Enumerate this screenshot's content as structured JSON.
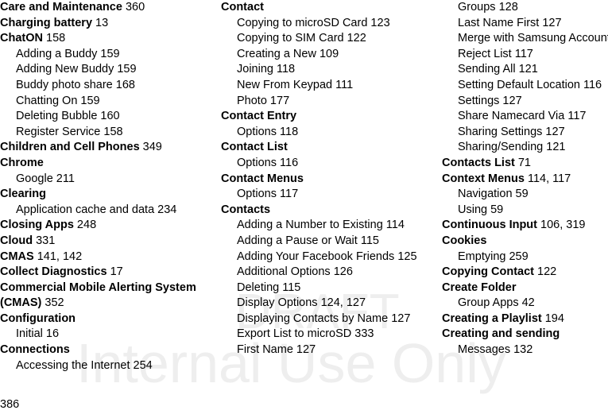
{
  "document": {
    "type": "book-index",
    "page_number": "386",
    "watermark": {
      "line1": "DRAFT",
      "line2": "Internal Use Only",
      "color": "#eeeeee"
    }
  },
  "columns": [
    {
      "id": "column-1",
      "entries": [
        {
          "level": "head",
          "title": "Care and Maintenance",
          "pages": "360"
        },
        {
          "level": "head",
          "title": "Charging battery",
          "pages": "13"
        },
        {
          "level": "head",
          "title": "ChatON",
          "pages": "158"
        },
        {
          "level": "sub",
          "title": "Adding a Buddy",
          "pages": "159"
        },
        {
          "level": "sub",
          "title": "Adding New Buddy",
          "pages": "159"
        },
        {
          "level": "sub",
          "title": "Buddy photo share",
          "pages": "168"
        },
        {
          "level": "sub",
          "title": "Chatting On",
          "pages": "159"
        },
        {
          "level": "sub",
          "title": "Deleting Bubble",
          "pages": "160"
        },
        {
          "level": "sub",
          "title": "Register Service",
          "pages": "158"
        },
        {
          "level": "head",
          "title": "Children and Cell Phones",
          "pages": "349"
        },
        {
          "level": "head",
          "title": "Chrome",
          "pages": ""
        },
        {
          "level": "sub",
          "title": "Google",
          "pages": "211"
        },
        {
          "level": "head",
          "title": "Clearing",
          "pages": ""
        },
        {
          "level": "sub",
          "title": "Application cache and data",
          "pages": "234"
        },
        {
          "level": "head",
          "title": "Closing Apps",
          "pages": "248"
        },
        {
          "level": "head",
          "title": "Cloud",
          "pages": "331"
        },
        {
          "level": "head",
          "title": "CMAS",
          "pages": "141, 142"
        },
        {
          "level": "head",
          "title": "Collect Diagnostics",
          "pages": "17"
        },
        {
          "level": "head",
          "title": "Commercial Mobile Alerting System (CMAS)",
          "pages": "352"
        },
        {
          "level": "head",
          "title": "Configuration",
          "pages": ""
        },
        {
          "level": "sub",
          "title": "Initial",
          "pages": "16"
        },
        {
          "level": "head",
          "title": "Connections",
          "pages": ""
        },
        {
          "level": "sub",
          "title": "Accessing the Internet",
          "pages": "254"
        }
      ]
    },
    {
      "id": "column-2",
      "entries": [
        {
          "level": "head",
          "title": "Contact",
          "pages": ""
        },
        {
          "level": "sub",
          "title": "Copying to microSD Card",
          "pages": "123"
        },
        {
          "level": "sub",
          "title": "Copying to SIM Card",
          "pages": "122"
        },
        {
          "level": "sub",
          "title": "Creating a New",
          "pages": "109"
        },
        {
          "level": "sub",
          "title": "Joining",
          "pages": "118"
        },
        {
          "level": "sub",
          "title": "New From Keypad",
          "pages": "111"
        },
        {
          "level": "sub",
          "title": "Photo",
          "pages": "177"
        },
        {
          "level": "head",
          "title": "Contact Entry",
          "pages": ""
        },
        {
          "level": "sub",
          "title": "Options",
          "pages": "118"
        },
        {
          "level": "head",
          "title": "Contact List",
          "pages": ""
        },
        {
          "level": "sub",
          "title": "Options",
          "pages": "116"
        },
        {
          "level": "head",
          "title": "Contact Menus",
          "pages": ""
        },
        {
          "level": "sub",
          "title": "Options",
          "pages": "117"
        },
        {
          "level": "head",
          "title": "Contacts",
          "pages": ""
        },
        {
          "level": "sub",
          "title": "Adding a Number to Existing",
          "pages": "114"
        },
        {
          "level": "sub",
          "title": "Adding a Pause or Wait",
          "pages": "115"
        },
        {
          "level": "sub",
          "title": "Adding Your Facebook Friends",
          "pages": "125"
        },
        {
          "level": "sub",
          "title": "Additional Options",
          "pages": "126"
        },
        {
          "level": "sub",
          "title": "Deleting",
          "pages": "115"
        },
        {
          "level": "sub",
          "title": "Display Options",
          "pages": "124, 127"
        },
        {
          "level": "sub",
          "title": "Displaying Contacts by Name",
          "pages": "127"
        },
        {
          "level": "sub",
          "title": "Export List to microSD",
          "pages": "333"
        },
        {
          "level": "sub",
          "title": "First Name",
          "pages": "127"
        }
      ]
    },
    {
      "id": "column-3",
      "entries": [
        {
          "level": "sub",
          "title": "Groups",
          "pages": "128"
        },
        {
          "level": "sub",
          "title": "Last Name First",
          "pages": "127"
        },
        {
          "level": "sub",
          "title": "Merge with Samsung Account",
          "pages": "116"
        },
        {
          "level": "sub",
          "title": "Reject List",
          "pages": "117"
        },
        {
          "level": "sub",
          "title": "Sending All",
          "pages": "121"
        },
        {
          "level": "sub",
          "title": "Setting Default Location",
          "pages": "116"
        },
        {
          "level": "sub",
          "title": "Settings",
          "pages": "127"
        },
        {
          "level": "sub",
          "title": "Share Namecard Via",
          "pages": "117"
        },
        {
          "level": "sub",
          "title": "Sharing Settings",
          "pages": "127"
        },
        {
          "level": "sub",
          "title": "Sharing/Sending",
          "pages": "121"
        },
        {
          "level": "head",
          "title": "Contacts List",
          "pages": "71"
        },
        {
          "level": "head",
          "title": "Context Menus",
          "pages": "114, 117"
        },
        {
          "level": "sub",
          "title": "Navigation",
          "pages": "59"
        },
        {
          "level": "sub",
          "title": "Using",
          "pages": "59"
        },
        {
          "level": "head",
          "title": "Continuous Input",
          "pages": "106, 319"
        },
        {
          "level": "head",
          "title": "Cookies",
          "pages": ""
        },
        {
          "level": "sub",
          "title": "Emptying",
          "pages": "259"
        },
        {
          "level": "head",
          "title": "Copying Contact",
          "pages": "122"
        },
        {
          "level": "head",
          "title": "Create Folder",
          "pages": ""
        },
        {
          "level": "sub",
          "title": "Group Apps",
          "pages": "42"
        },
        {
          "level": "head",
          "title": "Creating a Playlist",
          "pages": "194"
        },
        {
          "level": "head",
          "title": "Creating and sending",
          "pages": ""
        },
        {
          "level": "sub",
          "title": "Messages",
          "pages": "132"
        }
      ]
    }
  ]
}
